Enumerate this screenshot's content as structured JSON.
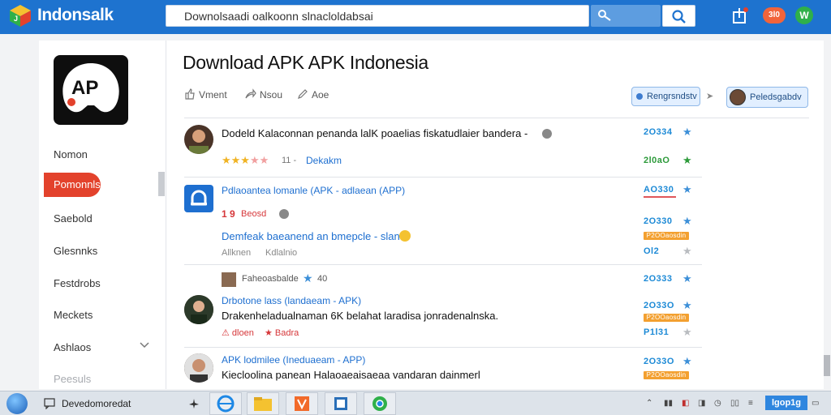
{
  "header": {
    "logo_text": "Indonsalk",
    "search_value": "Downolsaadi oalkoonn slnacloldabsai",
    "notif_badge": "3l0",
    "green_badge": "W"
  },
  "sidebar": {
    "items": [
      {
        "label": "Nomon"
      },
      {
        "label": "Pomonnls",
        "active": true
      },
      {
        "label": "Saebold"
      },
      {
        "label": "Glesnnks"
      },
      {
        "label": "Festdrobs"
      },
      {
        "label": "Meckets"
      },
      {
        "label": "Ashlaos"
      },
      {
        "label": "Peesuls"
      }
    ]
  },
  "main": {
    "title": "Download APK APK Indonesia",
    "actions": [
      "Vment",
      "Nsou",
      "Aoe"
    ],
    "sort_label": "Rengrsndstv",
    "user_label": "Peledsgabdv",
    "items": [
      {
        "title": "Dodeld Kalaconnan penanda lalK poaelias fiskatudlaier bandera -",
        "rating_count": "11 -",
        "tag": "Dekakm",
        "nums": [
          "2O334",
          "2l0aO"
        ]
      },
      {
        "title": "Pdlaoantea lomanle (APK - adlaean (APP)",
        "size": "1 9",
        "size_label": "Beosd",
        "nums": [
          "AO330"
        ]
      },
      {
        "title": "Demfeak baeanend an bmepcle - slan",
        "author": "Allknen",
        "author2": "Kdlalnio",
        "nums": [
          "2O330",
          "Ol2"
        ]
      },
      {
        "title": "Faheoasbalde",
        "count": "40",
        "nums": [
          "2O333"
        ]
      },
      {
        "title": "Drbotone lass (landaeam - APK)",
        "desc": "Drakenheladualnaman 6K belahat laradisa jonradenalnska.",
        "tag1": "dloen",
        "tag2": "Badra",
        "nums": [
          "2O33O",
          "P1l31"
        ]
      },
      {
        "title": "APK lodmilee (Ineduaeam - APP)",
        "desc": "Kiecloolina panean Halaoaeaisaeaa vandaran dainmerl",
        "nums": [
          "2O33O"
        ]
      }
    ],
    "badges": [
      "P2OOaosdin",
      "P2OOaosdin",
      "P2OOaosdin"
    ]
  },
  "taskbar": {
    "search_text": "Devedomoredat",
    "clock": "lgop1g"
  },
  "colors": {
    "brand_blue": "#1e73cf",
    "active_red": "#e3422c",
    "link_blue": "#1e6fd0",
    "accent_green": "#2c9a3a",
    "accent_orange": "#f3a030"
  }
}
